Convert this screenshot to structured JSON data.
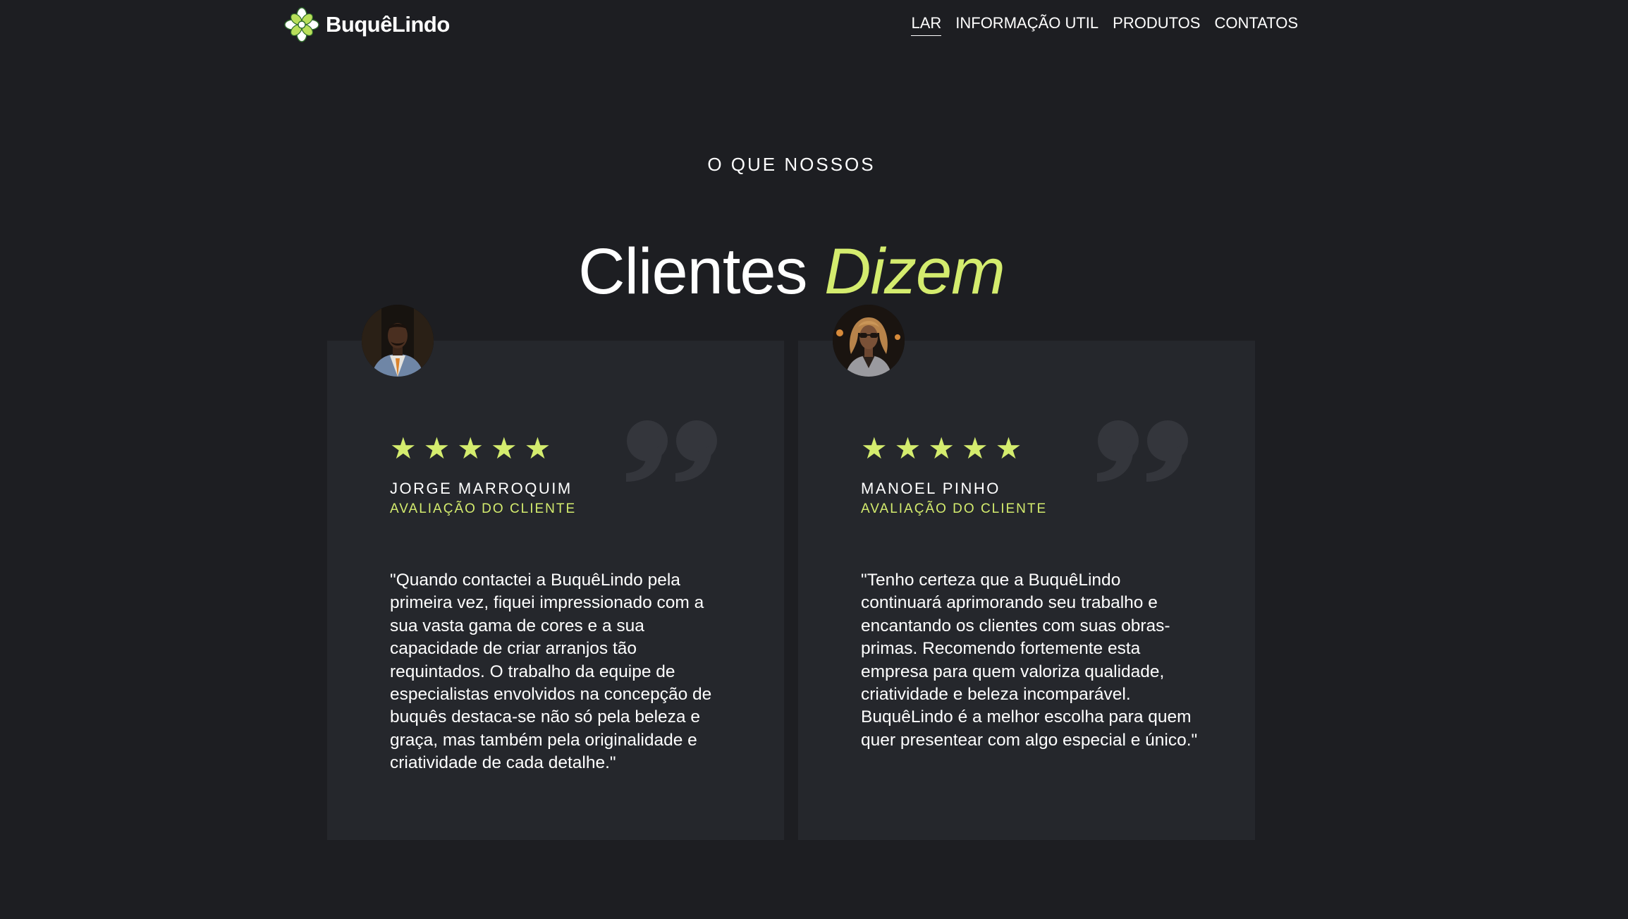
{
  "brand": {
    "name": "BuquêLindo",
    "logo_icon": "flower-logo-icon",
    "accent_color": "#d4ec6e"
  },
  "nav": {
    "items": [
      {
        "label": "LAR",
        "active": true
      },
      {
        "label": "INFORMAÇÃO UTIL",
        "active": false
      },
      {
        "label": "PRODUTOS",
        "active": false
      },
      {
        "label": "CONTATOS",
        "active": false
      }
    ]
  },
  "section": {
    "eyebrow": "O QUE NOSSOS",
    "title": "Clientes",
    "title_accent": "Dizem"
  },
  "testimonials": [
    {
      "name": "JORGE MARROQUIM",
      "role": "AVALIAÇÃO DO CLIENTE",
      "rating": 5,
      "avatar_icon": "avatar-photo",
      "text": "\"Quando contactei a BuquêLindo pela primeira vez, fiquei impressionado com a sua vasta gama de cores e a sua capacidade de criar arranjos tão requintados. O trabalho da equipe de especialistas envolvidos na concepção de buquês destaca-se não só pela beleza e graça, mas também pela originalidade e criatividade de cada detalhe.\""
    },
    {
      "name": "MANOEL PINHO",
      "role": "AVALIAÇÃO DO CLIENTE",
      "rating": 5,
      "avatar_icon": "avatar-photo",
      "text": "\"Tenho certeza que a BuquêLindo continuará aprimorando seu trabalho e encantando os clientes com suas obras-primas. Recomendo fortemente esta empresa para quem valoriza qualidade, criatividade e beleza incomparável. BuquêLindo é a melhor escolha para quem quer presentear com algo especial e único.\""
    }
  ]
}
